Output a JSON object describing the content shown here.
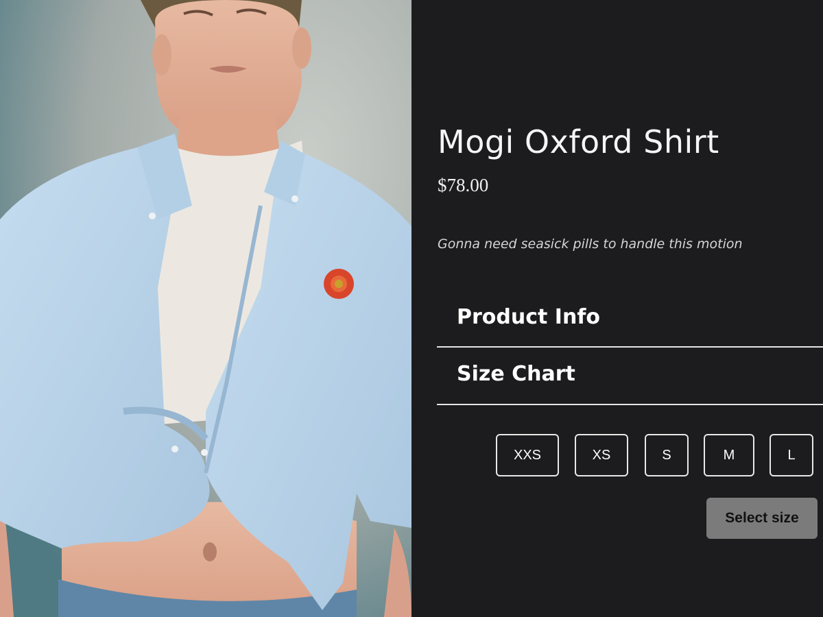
{
  "product": {
    "title": "Mogi Oxford Shirt",
    "price": "$78.00",
    "tagline": "Gonna need seasick pills to handle this motion"
  },
  "accordion": [
    {
      "label": "Product Info"
    },
    {
      "label": "Size Chart"
    }
  ],
  "sizes": [
    "XXS",
    "XS",
    "S",
    "M",
    "L"
  ],
  "select_button": {
    "label": "Select size"
  },
  "photo": {
    "subject": "model-in-light-blue-oxford-shirt",
    "shirt_color": "#b9d3ea",
    "patch_color": "#d9452b"
  },
  "colors": {
    "background": "#1c1b1d",
    "text": "#f5f5f5",
    "divider": "#e6e6e6",
    "select_button_bg": "#7b7b7b"
  }
}
